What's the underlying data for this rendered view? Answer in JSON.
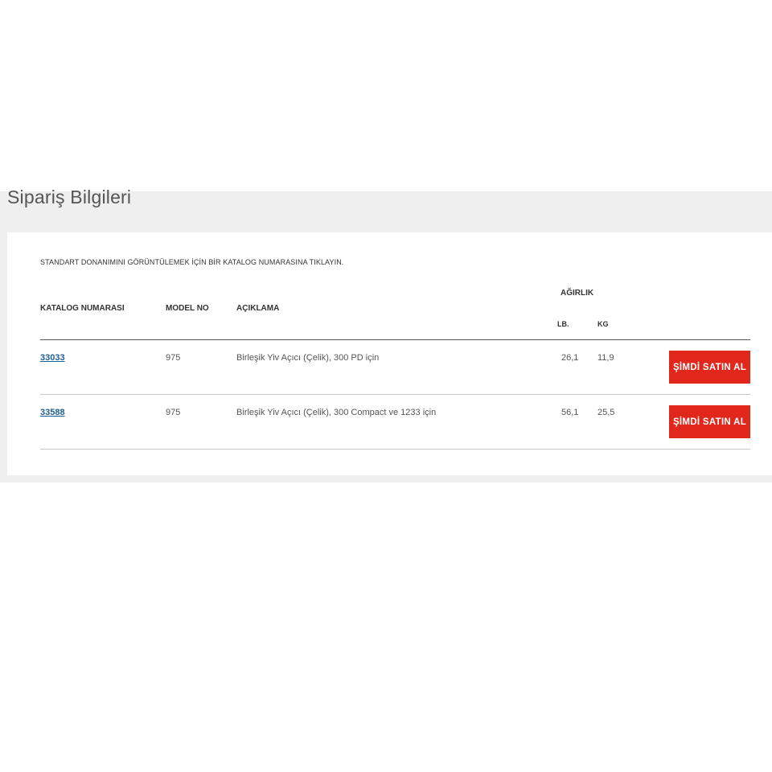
{
  "section": {
    "title": "Sipariş Bilgileri"
  },
  "instruction": "STANDART DONANIMINI GÖRÜNTÜLEMEK İÇİN BİR KATALOG NUMARASINA TIKLAYIN.",
  "table": {
    "headers": {
      "catalog": "KATALOG NUMARASI",
      "model": "MODEL NO",
      "description": "AÇIKLAMA",
      "weight": "AĞIRLIK",
      "lb": "LB.",
      "kg": "KG"
    },
    "rows": [
      {
        "catalog": "33033",
        "model": "975",
        "description": "Birleşik Yiv Açıcı (Çelik), 300 PD için",
        "lb": "26,1",
        "kg": "11,9",
        "button": "ŞİMDİ SATIN AL"
      },
      {
        "catalog": "33588",
        "model": "975",
        "description": "Birleşik Yiv Açıcı (Çelik), 300 Compact ve 1233 için",
        "lb": "56,1",
        "kg": "25,5",
        "button": "ŞİMDİ SATIN AL"
      }
    ]
  },
  "colors": {
    "button_bg": "#e1261c",
    "link": "#1f5f8f",
    "section_bg": "#efefef"
  }
}
